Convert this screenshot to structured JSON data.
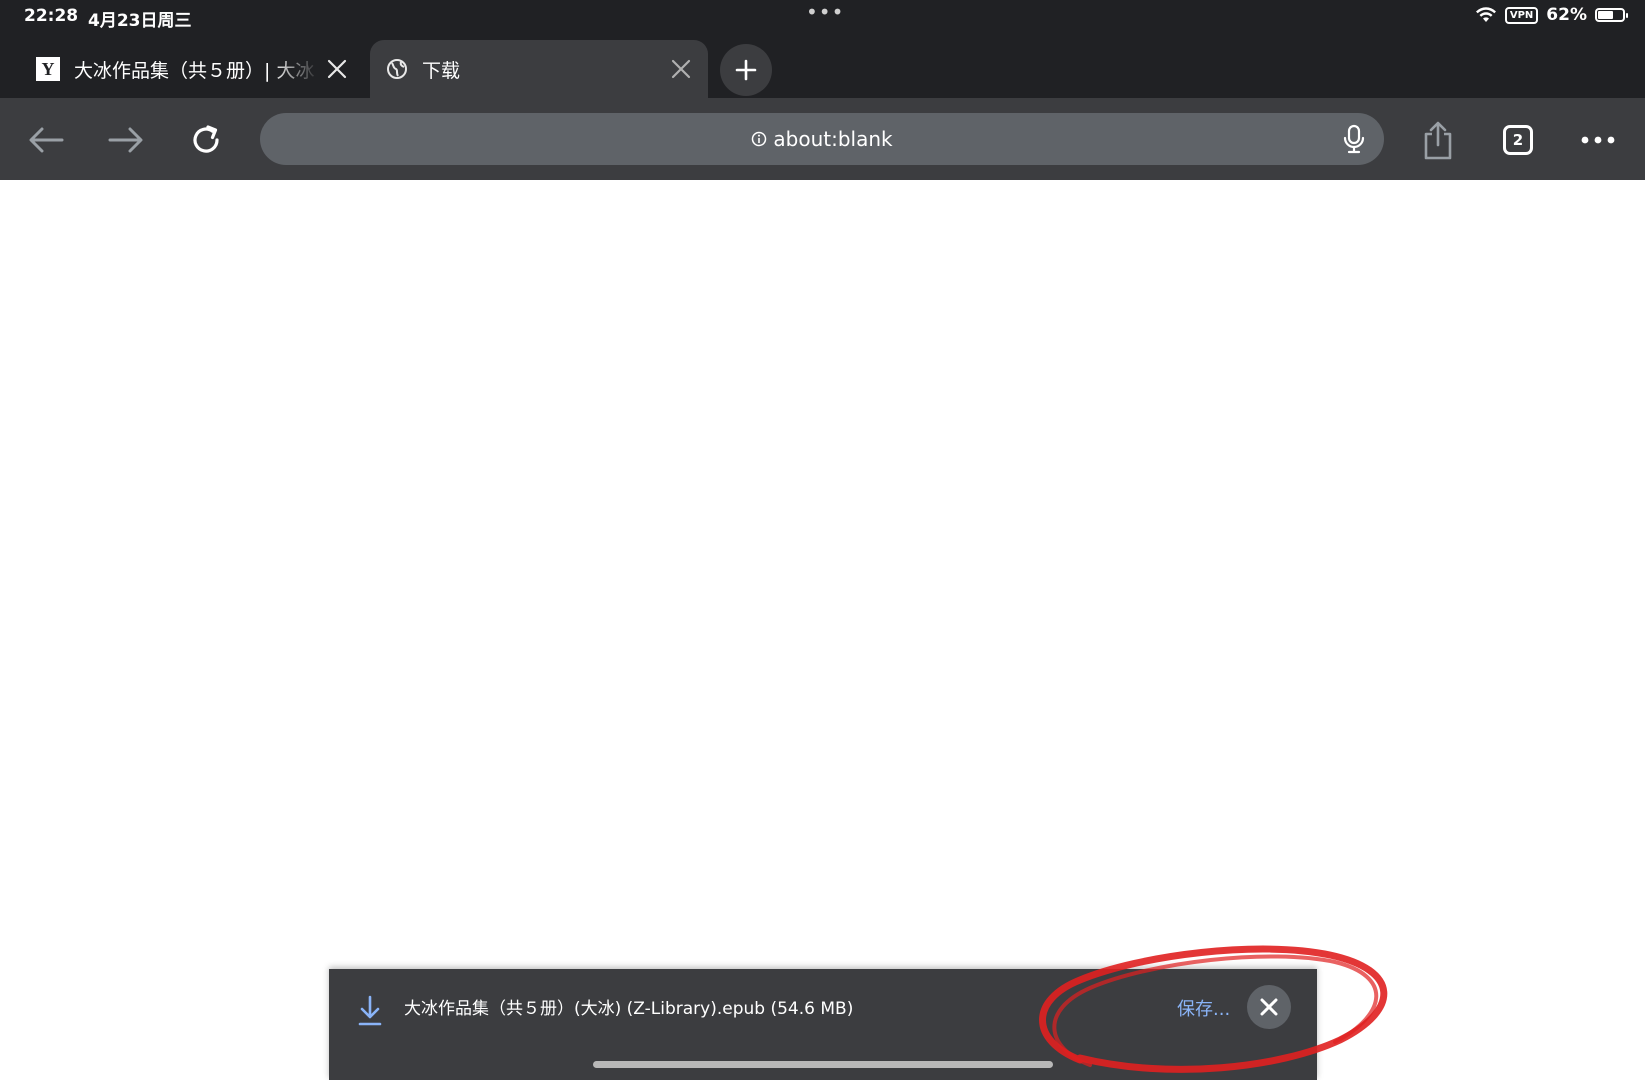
{
  "status_bar": {
    "time": "22:28",
    "date": "4月23日周三",
    "vpn_label": "VPN",
    "battery_percent_label": "62%",
    "battery_level": 0.62
  },
  "tabs": [
    {
      "title": "大冰作品集（共５册）| 大冰",
      "favicon": "Y",
      "active": false
    },
    {
      "title": "下载",
      "favicon": "globe-icon",
      "active": true
    }
  ],
  "toolbar": {
    "url": "about:blank",
    "tab_count": "2"
  },
  "download": {
    "filename": "大冰作品集（共５册）(大冰) (Z-Library).epub (54.6 MB)",
    "save_label": "保存..."
  },
  "colors": {
    "chrome_dark": "#202124",
    "toolbar": "#3c3d40",
    "omnibox": "#5f6368",
    "link_blue": "#8ab4f8",
    "annotation_red": "#e02020"
  }
}
